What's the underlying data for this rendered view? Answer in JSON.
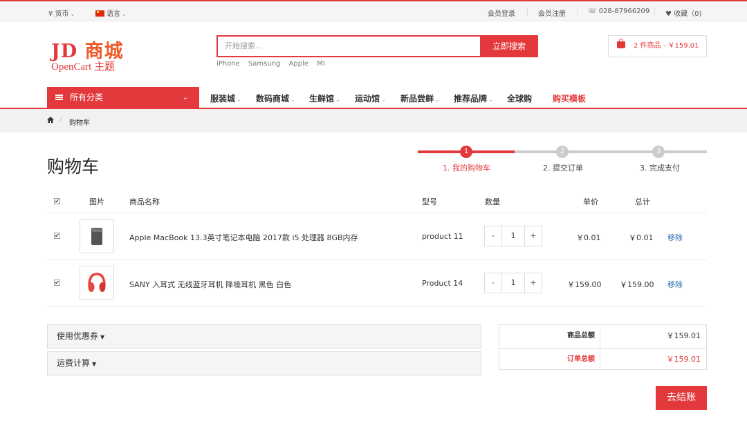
{
  "topbar": {
    "currency": "¥ 货币",
    "language": "语言",
    "login": "会员登录",
    "register": "会员注册",
    "phone": "028-87966209",
    "favorites": "收藏（0)"
  },
  "header": {
    "logo_main": "JD",
    "logo_mall": "商城",
    "logo_sub": "OpenCart 主题",
    "search_placeholder": "开始搜索...",
    "search_button": "立即搜索",
    "hotwords": [
      "iPhone",
      "Samsung",
      "Apple",
      "MI"
    ],
    "cart_summary": "2 件商品 - ￥159.01"
  },
  "nav": {
    "all_categories": "所有分类",
    "items": [
      {
        "label": "服装城",
        "dropdown": true
      },
      {
        "label": "数码商城",
        "dropdown": true
      },
      {
        "label": "生鲜馆",
        "dropdown": true
      },
      {
        "label": "运动馆",
        "dropdown": true
      },
      {
        "label": "新品尝鲜",
        "dropdown": true
      },
      {
        "label": "推荐品牌",
        "dropdown": true
      },
      {
        "label": "全球购",
        "dropdown": false
      },
      {
        "label": "购买模板",
        "dropdown": false
      }
    ]
  },
  "breadcrumb": {
    "current": "购物车"
  },
  "page": {
    "title": "购物车"
  },
  "steps": [
    {
      "num": "1",
      "label": "1. 我的购物车",
      "active": true
    },
    {
      "num": "2",
      "label": "2. 提交订单",
      "active": false
    },
    {
      "num": "3",
      "label": "3. 完成支付",
      "active": false
    }
  ],
  "table": {
    "headers": {
      "image": "图片",
      "name": "商品名称",
      "model": "型号",
      "quantity": "数量",
      "unit_price": "单价",
      "total": "总计"
    },
    "rows": [
      {
        "name": "Apple MacBook 13.3英寸笔记本电脑 2017款 i5 处理器 8GB内存",
        "model": "product 11",
        "quantity": "1",
        "unit_price": "￥0.01",
        "total": "￥0.01",
        "remove": "移除",
        "checked": true,
        "image": "speaker-gray"
      },
      {
        "name": "SANY 入耳式 无线蓝牙耳机 降噪耳机 黑色 白色",
        "model": "Product 14",
        "quantity": "1",
        "unit_price": "￥159.00",
        "total": "￥159.00",
        "remove": "移除",
        "checked": true,
        "image": "red-headphones"
      }
    ],
    "qty_minus": "-",
    "qty_plus": "+"
  },
  "panels": {
    "coupon": "使用优惠券",
    "shipping": "运费计算"
  },
  "totals": {
    "subtotal_label": "商品总额",
    "subtotal_value": "￥159.01",
    "total_label": "订单总额",
    "total_value": "￥159.01"
  },
  "checkout_button": "去结账",
  "colors": {
    "accent": "#e4393c",
    "link": "#2a6ab2",
    "step_inactive": "#cccccc"
  }
}
